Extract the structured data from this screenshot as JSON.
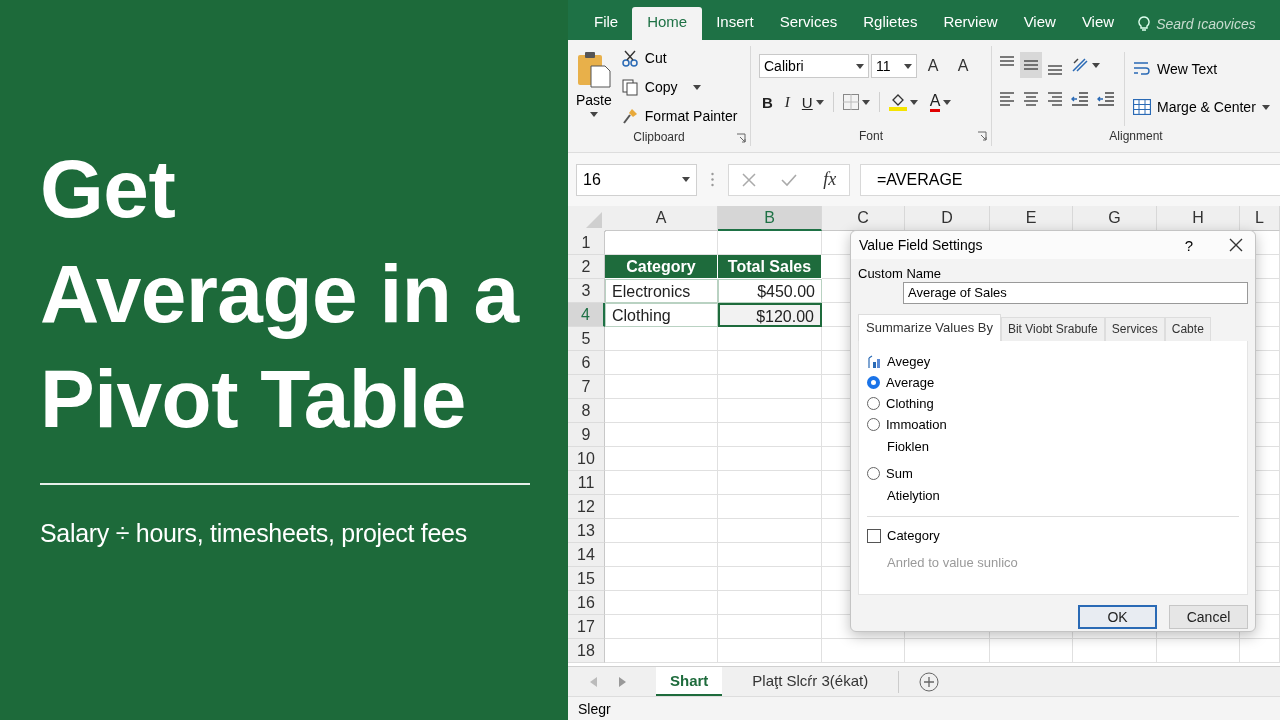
{
  "promo": {
    "title_lines": [
      "Get",
      "Average in a",
      "Pivot Table"
    ],
    "subtitle": "Salary ÷ hours, timesheets, project fees"
  },
  "ribbon": {
    "tabs": [
      {
        "label": "File",
        "selected": false
      },
      {
        "label": "Home",
        "selected": true
      },
      {
        "label": "Insert",
        "selected": false
      },
      {
        "label": "Services",
        "selected": false
      },
      {
        "label": "Rglietes",
        "selected": false
      },
      {
        "label": "Rerview",
        "selected": false
      },
      {
        "label": "View",
        "selected": false
      },
      {
        "label": "View",
        "selected": false
      }
    ],
    "search": {
      "placeholder": "Seard ıcaovices"
    },
    "clipboard": {
      "paste": "Paste",
      "cut": "Cut",
      "copy": "Copy",
      "format_painter": "Format Painter",
      "label": "Clipboard"
    },
    "font": {
      "name": "Calibri",
      "size": "11",
      "grow": "A",
      "shrink": "A",
      "bold": "B",
      "italic": "I",
      "underline": "U",
      "color_letter": "A",
      "label": "Font"
    },
    "alignment": {
      "vertical": [
        {
          "kind": "top",
          "selected": false
        },
        {
          "kind": "middle",
          "selected": true
        },
        {
          "kind": "bottom",
          "selected": false
        }
      ],
      "wrap": "Wew Text",
      "merge": "Marge & Center",
      "label": "Alignment"
    }
  },
  "formula_bar": {
    "name_box": "16",
    "fx": "fx",
    "formula": "=AVERAGE"
  },
  "sheet": {
    "columns": [
      "A",
      "B",
      "C",
      "D",
      "E",
      "G",
      "H",
      "L"
    ],
    "rows": [
      {
        "number": "1"
      },
      {
        "number": "2",
        "cells": [
          {
            "text": "Category",
            "kind": "header",
            "selected": false
          },
          {
            "text": "Total Sales",
            "kind": "header",
            "selected": false
          }
        ]
      },
      {
        "number": "3",
        "cells": [
          {
            "text": "Electronics",
            "kind": "text",
            "selected": false
          },
          {
            "text": "$450.00",
            "kind": "money",
            "selected": false
          }
        ]
      },
      {
        "number": "4",
        "cells": [
          {
            "text": "Clothing",
            "kind": "text",
            "selected": false
          },
          {
            "text": "$120.00",
            "kind": "money",
            "selected": true
          }
        ]
      },
      {
        "number": "5"
      },
      {
        "number": "6"
      },
      {
        "number": "7"
      },
      {
        "number": "8"
      },
      {
        "number": "9"
      },
      {
        "number": "10"
      },
      {
        "number": "11"
      },
      {
        "number": "12"
      },
      {
        "number": "13"
      },
      {
        "number": "14"
      },
      {
        "number": "15"
      },
      {
        "number": "16"
      },
      {
        "number": "17"
      },
      {
        "number": "18"
      }
    ]
  },
  "dialog": {
    "title": "Value Field Settings",
    "help": "?",
    "custom_name_label": "Custom Name",
    "custom_name": "Average of Sales",
    "tabs": [
      {
        "label": "Summarize Values By",
        "selected": true
      },
      {
        "label": "Bit Viobt Srabufe",
        "selected": false
      },
      {
        "label": "Services",
        "selected": false
      },
      {
        "label": "Cabte",
        "selected": false
      }
    ],
    "items": [
      {
        "kind": "icon",
        "text": "Avegey"
      },
      {
        "kind": "radio",
        "text": "Average",
        "selected": true
      },
      {
        "kind": "radio",
        "text": "Clothing",
        "selected": false
      },
      {
        "kind": "radio",
        "text": "Immoation",
        "selected": false
      },
      {
        "kind": "sub",
        "text": "Fioklen"
      },
      {
        "kind": "radio",
        "text": "Sum",
        "selected": false
      },
      {
        "kind": "sub",
        "text": "Atielytion"
      },
      {
        "kind": "divider"
      },
      {
        "kind": "checkbox",
        "text": "Category",
        "checked": false
      },
      {
        "kind": "note",
        "text": "Anrled to value sunlico"
      }
    ],
    "buttons": [
      {
        "label": "OK",
        "default": true
      },
      {
        "label": "Cancel",
        "default": false
      }
    ]
  },
  "sheet_tabs": [
    {
      "label": "Shart",
      "selected": true
    },
    {
      "label": "Plaţt Slcŕr 3(ékat)",
      "selected": false
    }
  ],
  "status_bar": "Slegr"
}
